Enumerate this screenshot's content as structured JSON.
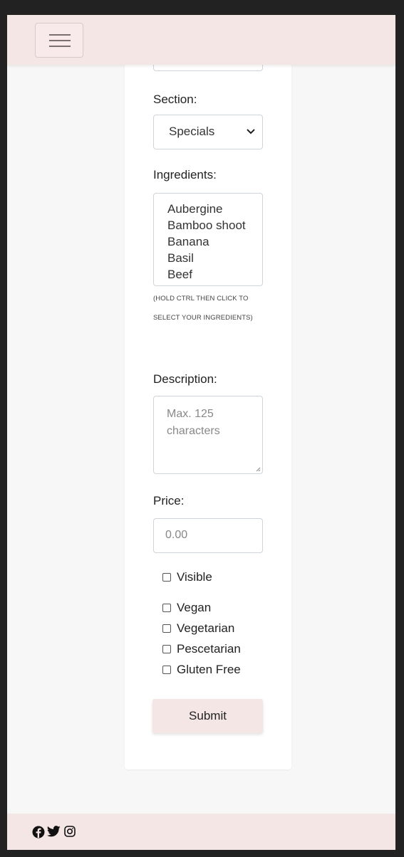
{
  "nav": {
    "menu_icon": "hamburger-icon"
  },
  "form": {
    "section": {
      "label": "Section:",
      "value": "Specials"
    },
    "ingredients": {
      "label": "Ingredients:",
      "options": [
        "Aubergine",
        "Bamboo shoot",
        "Banana",
        "Basil",
        "Beef"
      ],
      "hint": "(HOLD CTRL THEN CLICK TO SELECT YOUR INGREDIENTS)"
    },
    "description": {
      "label": "Description:",
      "placeholder": "Max. 125 characters"
    },
    "price": {
      "label": "Price:",
      "placeholder": "0.00"
    },
    "checkboxes": {
      "visible": "Visible",
      "vegan": "Vegan",
      "vegetarian": "Vegetarian",
      "pescetarian": "Pescetarian",
      "gluten_free": "Gluten Free"
    },
    "submit_label": "Submit"
  },
  "footer": {
    "icons": [
      "facebook-icon",
      "twitter-icon",
      "instagram-icon"
    ]
  },
  "colors": {
    "accent": "#f5e6e6",
    "page_bg": "#f7f7f7",
    "frame": "#222222"
  }
}
